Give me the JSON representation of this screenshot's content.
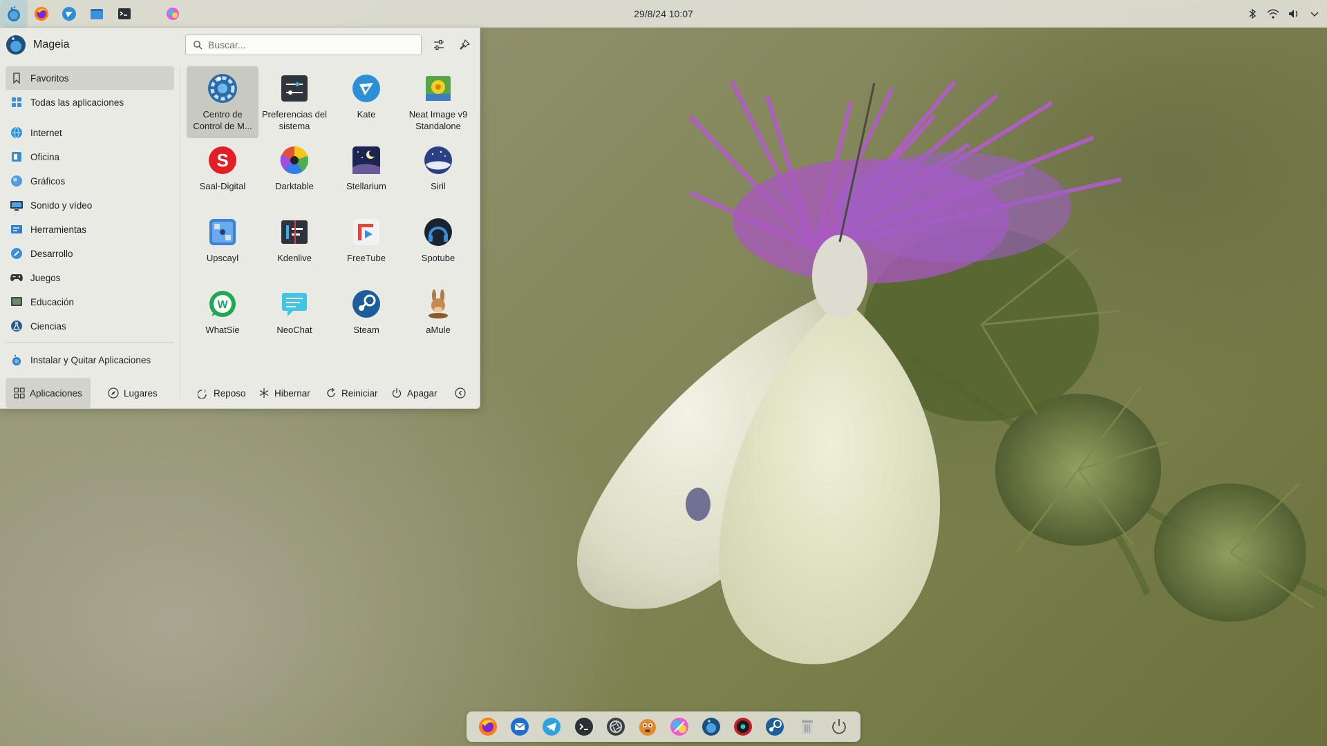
{
  "top_panel": {
    "clock": "29/8/24 10:07",
    "launcher_icon": "mageia-icon",
    "task_icons": [
      "firefox-icon",
      "kate-icon",
      "file-manager-icon",
      "terminal-icon",
      "gimp-like-icon"
    ],
    "tray": [
      "bluetooth-icon",
      "wifi-icon",
      "volume-icon",
      "expand-icon"
    ]
  },
  "launcher": {
    "user_name": "Mageia",
    "search": {
      "placeholder": "Buscar...",
      "value": ""
    },
    "sidebar": {
      "favorites": "Favoritos",
      "all_apps": "Todas las aplicaciones",
      "categories": [
        {
          "label": "Internet",
          "icon": "internet-icon"
        },
        {
          "label": "Oficina",
          "icon": "office-icon"
        },
        {
          "label": "Gráficos",
          "icon": "graphics-icon"
        },
        {
          "label": "Sonido y vídeo",
          "icon": "multimedia-icon"
        },
        {
          "label": "Herramientas",
          "icon": "tools-icon"
        },
        {
          "label": "Desarrollo",
          "icon": "development-icon"
        },
        {
          "label": "Juegos",
          "icon": "games-icon"
        },
        {
          "label": "Educación",
          "icon": "education-icon"
        },
        {
          "label": "Ciencias",
          "icon": "science-icon"
        }
      ],
      "install": "Instalar y Quitar Aplicaciones"
    },
    "apps": [
      {
        "label": "Centro de Control de M...",
        "icon": "control-center-icon"
      },
      {
        "label": "Preferencias del sistema",
        "icon": "system-settings-icon"
      },
      {
        "label": "Kate",
        "icon": "kate-icon"
      },
      {
        "label": "Neat Image v9 Standalone",
        "icon": "neat-image-icon"
      },
      {
        "label": "Saal-Digital",
        "icon": "saal-digital-icon"
      },
      {
        "label": "Darktable",
        "icon": "darktable-icon"
      },
      {
        "label": "Stellarium",
        "icon": "stellarium-icon"
      },
      {
        "label": "Siril",
        "icon": "siril-icon"
      },
      {
        "label": "Upscayl",
        "icon": "upscayl-icon"
      },
      {
        "label": "Kdenlive",
        "icon": "kdenlive-icon"
      },
      {
        "label": "FreeTube",
        "icon": "freetube-icon"
      },
      {
        "label": "Spotube",
        "icon": "spotube-icon"
      },
      {
        "label": "WhatSie",
        "icon": "whatsie-icon"
      },
      {
        "label": "NeoChat",
        "icon": "neochat-icon"
      },
      {
        "label": "Steam",
        "icon": "steam-icon"
      },
      {
        "label": "aMule",
        "icon": "amule-icon"
      }
    ],
    "footer": {
      "applications": "Aplicaciones",
      "places": "Lugares",
      "sleep": "Reposo",
      "hibernate": "Hibernar",
      "restart": "Reiniciar",
      "shutdown": "Apagar"
    }
  },
  "dock": {
    "icons": [
      "firefox-icon",
      "thunderbird-icon",
      "telegram-icon",
      "terminal-icon",
      "darktable-icon",
      "gimp-icon",
      "color-app-icon",
      "mageia-icon",
      "record-icon",
      "steam-icon",
      "trash-icon",
      "power-icon"
    ]
  },
  "colors": {
    "accent": "#3daee9",
    "menu_bg": "#e9eae4",
    "panel_bg": "#dfe0d6"
  }
}
